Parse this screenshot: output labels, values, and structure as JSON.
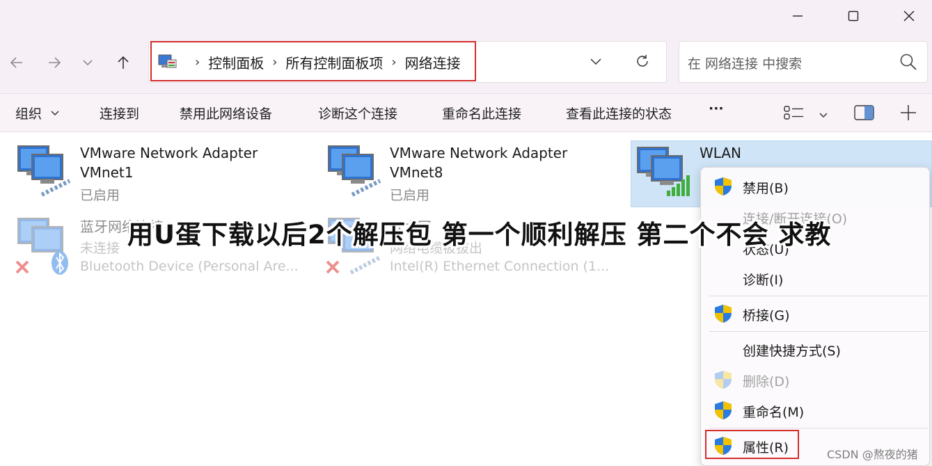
{
  "window": {
    "minimize_icon": "minimize-icon",
    "maximize_icon": "maximize-icon",
    "close_icon": "close-icon"
  },
  "nav": {
    "back_icon": "arrow-left-icon",
    "forward_icon": "arrow-right-icon",
    "recent_icon": "chevron-down-icon",
    "up_icon": "arrow-up-icon"
  },
  "address": {
    "crumbs": [
      "控制面板",
      "所有控制面板项",
      "网络连接"
    ],
    "separator": "›",
    "dropdown_icon": "chevron-down-icon",
    "refresh_icon": "refresh-icon"
  },
  "search": {
    "placeholder": "在 网络连接 中搜索",
    "icon": "search-icon"
  },
  "commands": {
    "organize": "组织",
    "connect_to": "连接到",
    "disable_device": "禁用此网络设备",
    "diagnose": "诊断这个连接",
    "rename": "重命名此连接",
    "view_status": "查看此连接的状态",
    "more": "···"
  },
  "connections": [
    {
      "name_line1": "VMware Network Adapter",
      "name_line2": "VMnet1",
      "status": "已启用",
      "device": ""
    },
    {
      "name_line1": "VMware Network Adapter",
      "name_line2": "VMnet8",
      "status": "已启用",
      "device": ""
    },
    {
      "name_line1": "WLAN",
      "name_line2": "",
      "status": "",
      "device": ""
    },
    {
      "name_line1": "蓝牙网络连接",
      "name_line2": "",
      "status": "未连接",
      "device": "Bluetooth Device (Personal Are..."
    },
    {
      "name_line1": "以太网",
      "name_line2": "",
      "status": "网络电缆被拔出",
      "device": "Intel(R) Ethernet Connection (1..."
    }
  ],
  "context_menu": {
    "items": [
      {
        "label": "禁用(B)",
        "shield": true,
        "disabled": false
      },
      {
        "label": "连接/断开连接(O)",
        "shield": false,
        "disabled": true
      },
      {
        "label": "状态(U)",
        "shield": false,
        "disabled": false
      },
      {
        "label": "诊断(I)",
        "shield": false,
        "disabled": false
      },
      {
        "label": "桥接(G)",
        "shield": true,
        "disabled": false
      },
      {
        "label": "创建快捷方式(S)",
        "shield": false,
        "disabled": false
      },
      {
        "label": "删除(D)",
        "shield": true,
        "disabled": true
      },
      {
        "label": "重命名(M)",
        "shield": true,
        "disabled": false
      },
      {
        "label": "属性(R)",
        "shield": true,
        "disabled": false
      }
    ]
  },
  "overlay": {
    "question": "用U蛋下载以后2个解压包 第一个顺利解压 第二个不会 求教",
    "watermark": "CSDN @熬夜的猪"
  },
  "colors": {
    "highlight_border": "#d42b2b",
    "selection_bg": "#cfe4f7",
    "chrome_bg": "#f6eff5"
  }
}
